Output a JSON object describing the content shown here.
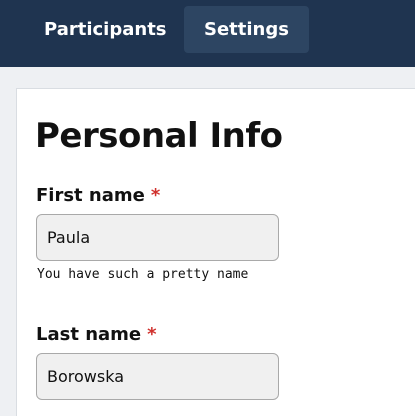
{
  "nav": {
    "tabs": [
      {
        "label": "Participants",
        "active": false
      },
      {
        "label": "Settings",
        "active": true
      }
    ]
  },
  "form": {
    "title": "Personal Info",
    "required_marker": "*",
    "first_name": {
      "label": "First name",
      "value": "Paula",
      "help": "You have such a pretty name"
    },
    "last_name": {
      "label": "Last name",
      "value": "Borowska"
    }
  },
  "colors": {
    "navbar": "#1f3450",
    "active_tab": "#2d4562",
    "required": "#d0312d",
    "input_bg": "#f0f0f0"
  }
}
